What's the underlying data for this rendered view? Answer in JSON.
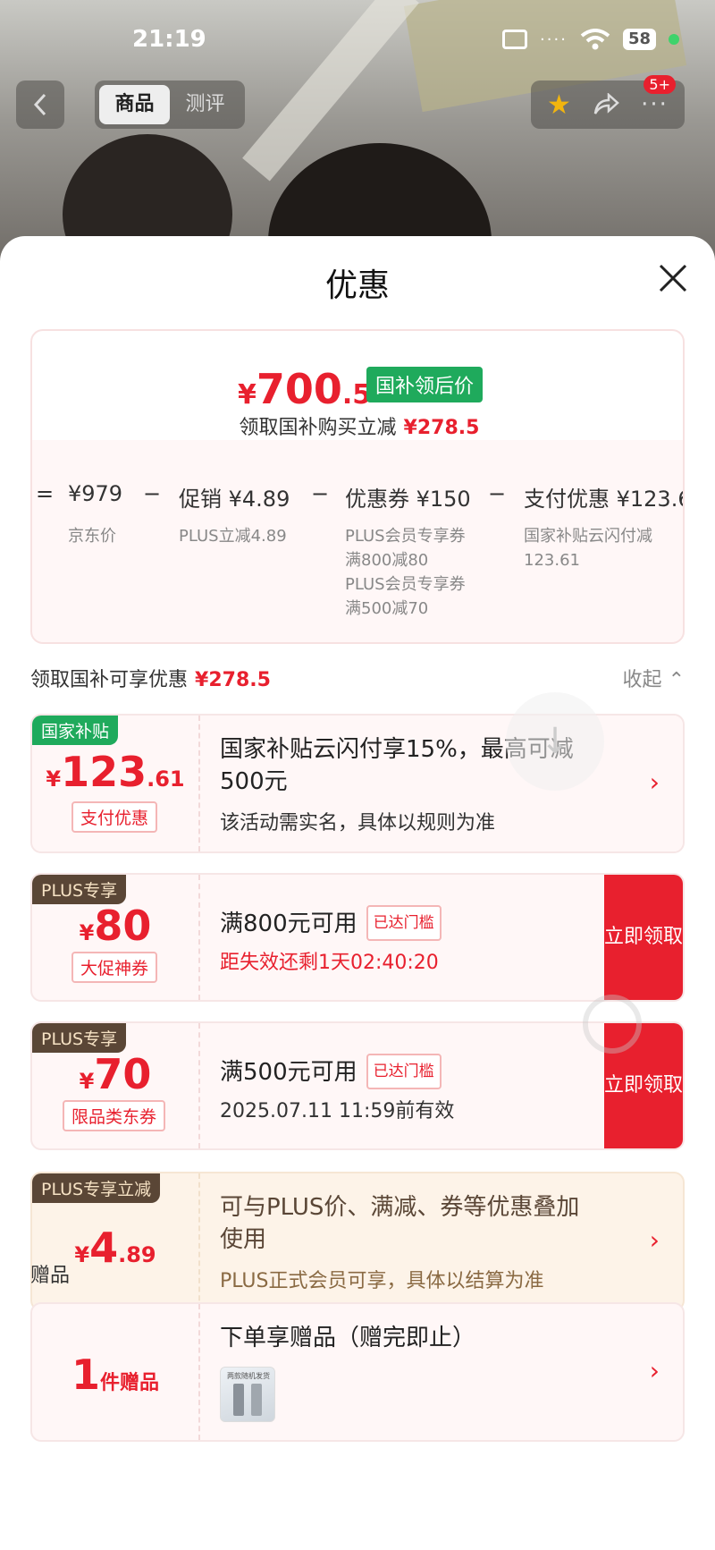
{
  "status_bar": {
    "time": "21:19",
    "battery": "58"
  },
  "nav": {
    "tabs": [
      "商品",
      "测评"
    ],
    "badge": "5+"
  },
  "sheet": {
    "title": "优惠"
  },
  "summary": {
    "price_yen": "¥",
    "price_int": "700",
    "price_dec": ".5",
    "price_tag": "国补领后价",
    "sub_text": "领取国补购买立减",
    "sub_amount": "¥278.5",
    "calc": {
      "eq": "=",
      "jd_price": "¥979",
      "minus": "−",
      "promo": "促销 ¥4.89",
      "coupon": "优惠券 ¥150",
      "pay": "支付优惠 ¥123.6",
      "jd_label": "京东价",
      "promo_sub": "PLUS立减4.89",
      "coupon_sub1": "PLUS会员专享券满800减80",
      "coupon_sub2": "PLUS会员专享券满500减70",
      "pay_sub": "国家补贴云闪付减123.61"
    }
  },
  "section": {
    "label": "领取国补可享优惠",
    "amount": "¥278.5",
    "collapse": "收起"
  },
  "offers": [
    {
      "corner": "国家补贴",
      "yen": "¥",
      "int": "123",
      "dec": ".61",
      "pill": "支付优惠",
      "title1": "国家补贴云闪付享15%，最高可减",
      "title2": "500元",
      "desc": "该活动需实名，具体以规则为准"
    },
    {
      "corner": "PLUS专享",
      "yen": "¥",
      "int": "80",
      "dec": "",
      "pill": "大促神券",
      "title": "满800元可用",
      "reached": "已达门槛",
      "desc": "距失效还剩1天02:40:20",
      "claim": "立即领取"
    },
    {
      "corner": "PLUS专享",
      "yen": "¥",
      "int": "70",
      "dec": "",
      "pill": "限品类东券",
      "title": "满500元可用",
      "reached": "已达门槛",
      "desc": "2025.07.11 11:59前有效",
      "claim": "立即领取"
    },
    {
      "corner": "PLUS专享立减",
      "yen": "¥",
      "int": "4",
      "dec": ".89",
      "title1": "可与PLUS价、满减、券等优惠叠加",
      "title2": "使用",
      "desc": "PLUS正式会员可享，具体以结算为准"
    }
  ],
  "gift": {
    "section": "赠品",
    "count": "1",
    "count_label": "件赠品",
    "title": "下单享赠品（赠完即止）",
    "img_caption": "两款随机发货"
  },
  "colors": {
    "accent": "#e8202e",
    "green": "#1faa5c",
    "plus_brown": "#5a4636"
  }
}
